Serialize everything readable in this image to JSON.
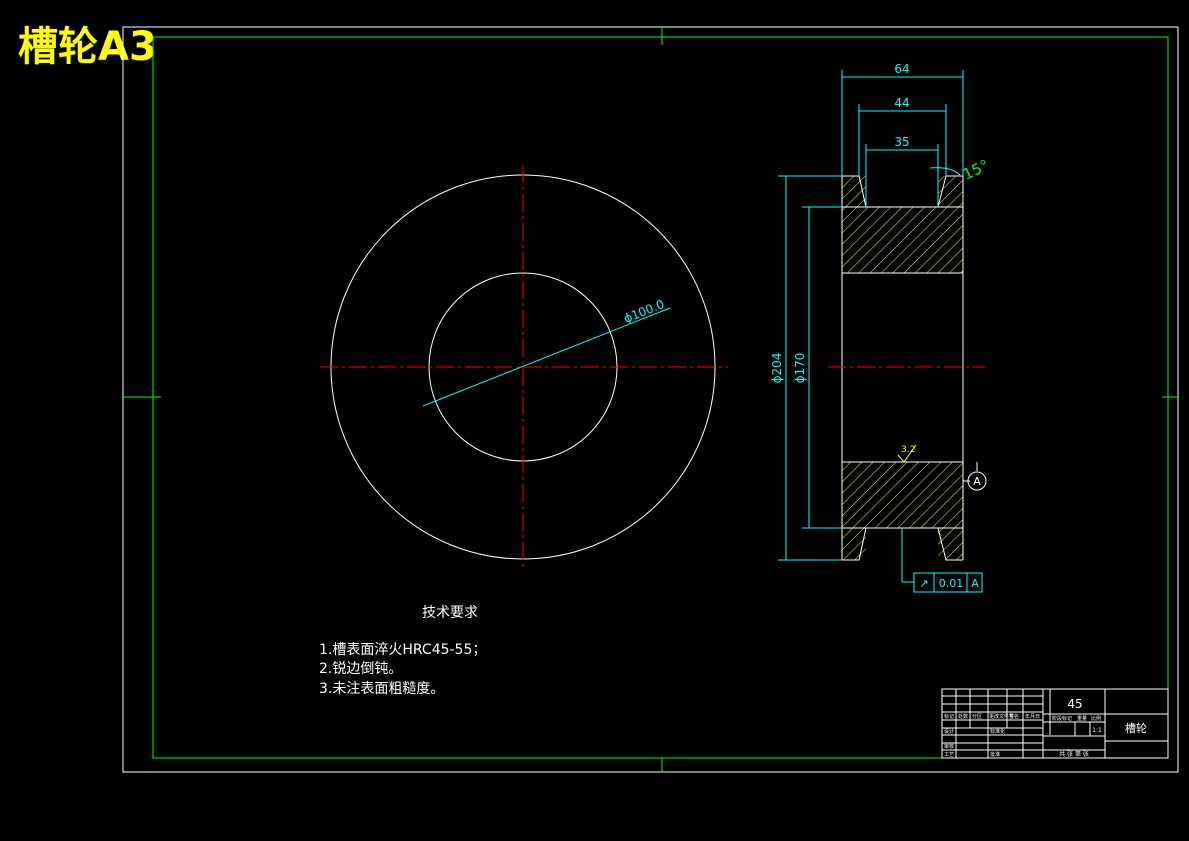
{
  "title": "槽轮A3",
  "colors": {
    "background": "#000000",
    "outline": "#ffffff",
    "frame": "#00ff00",
    "dimension": "#00ffff",
    "centerline": "#ff0000",
    "hatch": "#ffff00",
    "title_text": "#ffff00"
  },
  "front_view": {
    "diameter_label": "ϕ100.0"
  },
  "section_view": {
    "dim_width_overall": "64",
    "dim_width_mid": "44",
    "dim_groove_width": "35",
    "dim_angle": "15°",
    "dim_outer_diameter": "ϕ204",
    "dim_inner_diameter": "ϕ170",
    "roughness": "3.2",
    "datum": "A",
    "tolerance": {
      "symbol": "↗",
      "value": "0.01",
      "datum": "A"
    }
  },
  "tech_requirements": {
    "heading": "技术要求",
    "items": [
      "1.槽表面淬火HRC45-55；",
      "2.锐边倒钝。",
      "3.未注表面粗糙度。"
    ]
  },
  "title_block": {
    "material": "45",
    "part_name": "槽轮",
    "scale": "1:1",
    "sheet": "共 张 第 张",
    "row_labels": [
      "标记",
      "设计",
      "审核",
      "工艺"
    ],
    "header_cells": [
      "处数",
      "分区",
      "更改文件号",
      "签名",
      "年月日"
    ],
    "stage_labels": [
      "阶段标记",
      "重量",
      "比例"
    ],
    "misc": [
      "标准化",
      "批准"
    ]
  }
}
